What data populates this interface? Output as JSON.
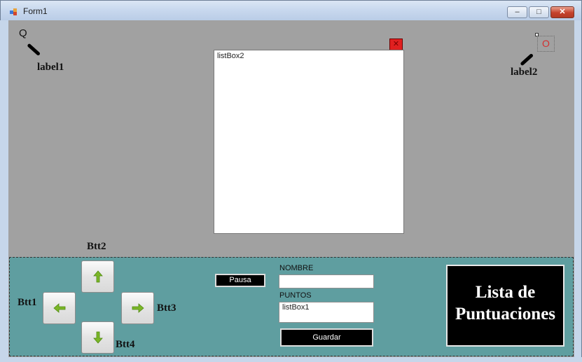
{
  "window": {
    "title": "Form1",
    "controls": {
      "minimize": "–",
      "maximize": "□",
      "close": "✕"
    }
  },
  "top_left": {
    "glyph": "Q",
    "label": "label1"
  },
  "top_right": {
    "glyph": "O",
    "label": "label2"
  },
  "listbox2": {
    "text": "listBox2"
  },
  "close_small": {
    "glyph": "✕"
  },
  "controls": {
    "btt1": "Btt1",
    "btt2": "Btt2",
    "btt3": "Btt3",
    "btt4": "Btt4",
    "pausa": "Pausa",
    "nombre_label": "NOMBRE",
    "puntos_label": "PUNTOS",
    "listbox1": "listBox1",
    "guardar": "Guardar",
    "lista_line1": "Lista de",
    "lista_line2": "Puntuaciones"
  },
  "colors": {
    "panel": "#5f9ea0",
    "client": "#a1a1a1",
    "arrow": "#7bb628"
  },
  "icons": [
    "app-icon",
    "arrow-up-icon",
    "arrow-left-icon",
    "arrow-right-icon",
    "arrow-down-icon"
  ]
}
